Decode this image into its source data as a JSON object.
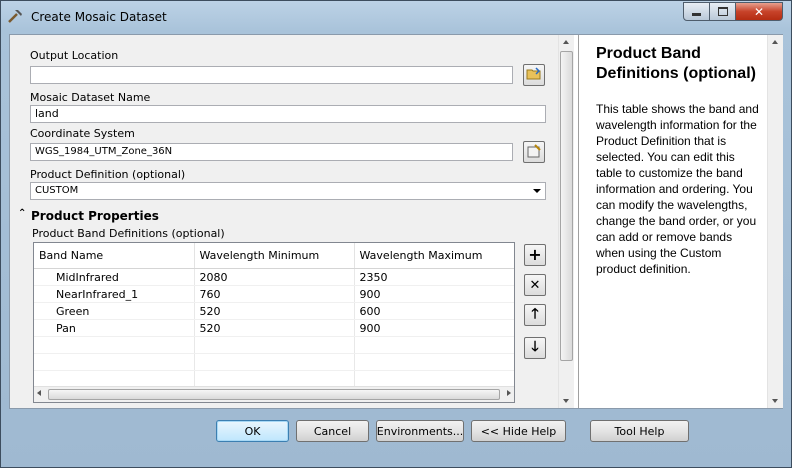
{
  "window": {
    "title": "Create Mosaic Dataset",
    "title_icon": "hammer-icon",
    "caption_icons": [
      "minimize-icon",
      "maximize-icon",
      "close-icon"
    ]
  },
  "form": {
    "output_location": {
      "label": "Output Location",
      "value": ""
    },
    "mosaic_name": {
      "label": "Mosaic Dataset Name",
      "value": "land"
    },
    "coordinate_system": {
      "label": "Coordinate System",
      "value": "WGS_1984_UTM_Zone_36N"
    },
    "product_definition": {
      "label": "Product Definition (optional)",
      "value": "CUSTOM"
    },
    "section": {
      "title": "Product Properties",
      "icon": "collapse-chevron-icon"
    },
    "band_table": {
      "label": "Product Band Definitions (optional)",
      "columns": [
        "Band Name",
        "Wavelength Minimum",
        "Wavelength Maximum"
      ],
      "rows": [
        [
          "MidInfrared",
          "2080",
          "2350"
        ],
        [
          "NearInfrared_1",
          "760",
          "900"
        ],
        [
          "Green",
          "520",
          "600"
        ],
        [
          "Pan",
          "520",
          "900"
        ]
      ]
    },
    "side_buttons": [
      "add-icon",
      "remove-icon",
      "move-up-icon",
      "move-down-icon"
    ]
  },
  "help": {
    "title": "Product Band Definitions (optional)",
    "text": "This table shows the band and wavelength information for the Product Definition that is selected. You can edit this table to customize the band information and ordering. You can modify the wavelengths, change the band order, or you can add or remove bands when using the Custom product definition."
  },
  "buttons": {
    "ok": "OK",
    "cancel": "Cancel",
    "environments": "Environments...",
    "hide_help": "<< Hide Help",
    "tool_help": "Tool Help"
  }
}
